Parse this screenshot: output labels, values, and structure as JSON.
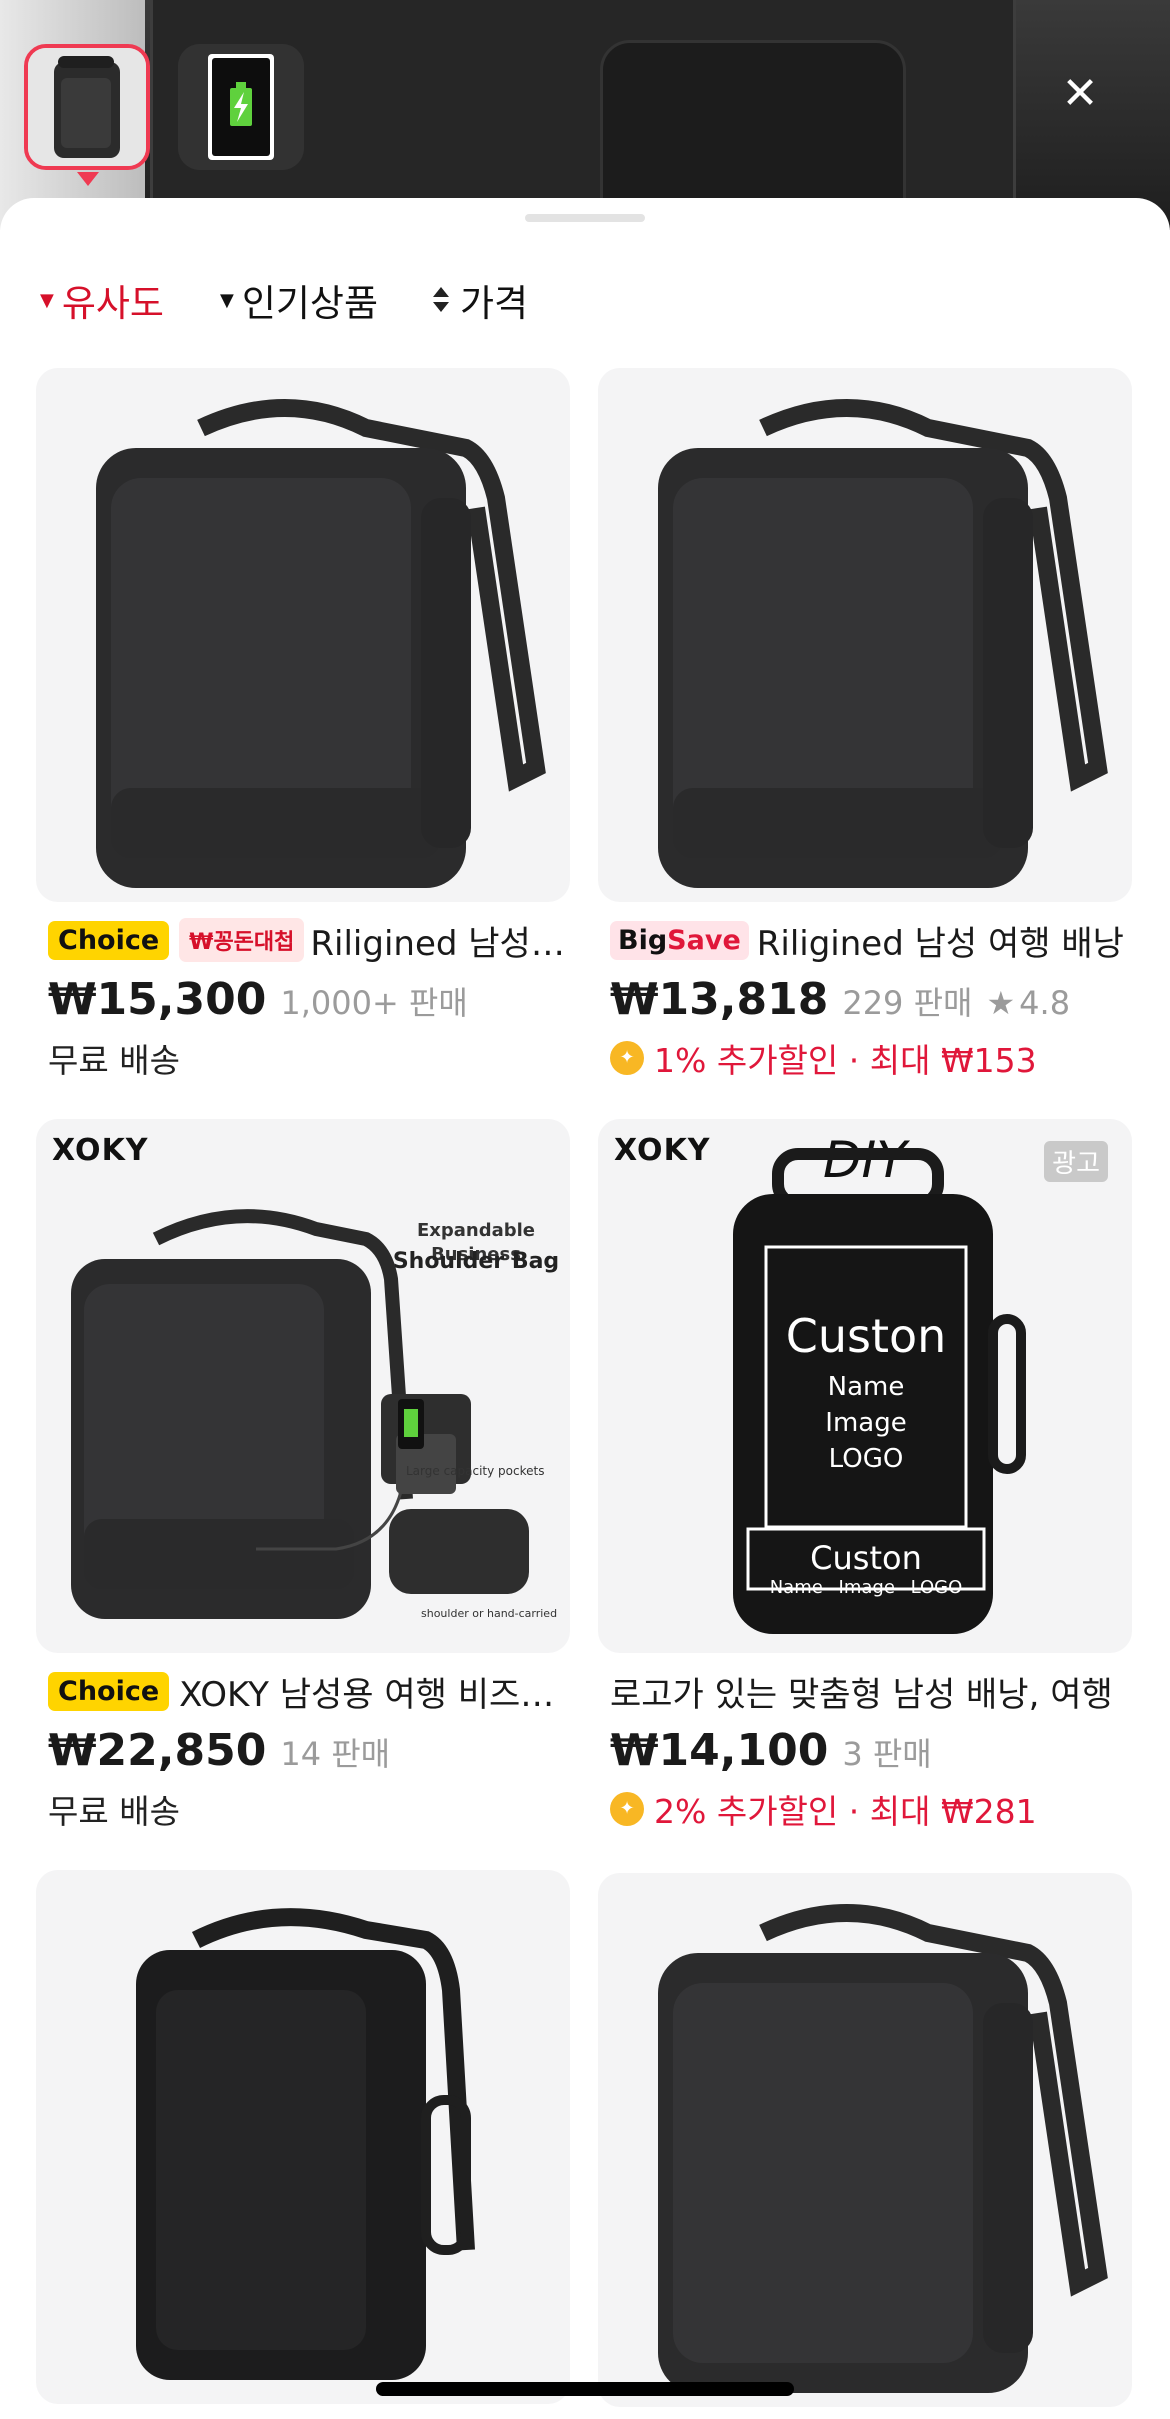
{
  "header": {
    "thumbnails": [
      {
        "icon": "backpack-icon",
        "selected": true
      },
      {
        "icon": "battery-charging-icon",
        "selected": false
      }
    ],
    "close_icon": "close-icon"
  },
  "sort": {
    "similarity": "유사도",
    "popular": "인기상품",
    "price": "가격"
  },
  "products": [
    {
      "badges": [
        "Choice",
        "₩꽁돈대첩"
      ],
      "title": "Riligined 남성 여행 배낭",
      "price": "₩15,300",
      "sold": "1,000+ 판매",
      "sub": "무료 배송"
    },
    {
      "badge_big": "Big",
      "badge_save": "Save",
      "title": "Riligined 남성 여행 배낭",
      "price": "₩13,818",
      "sold": "229 판매",
      "rating": "4.8",
      "promo": "1% 추가할인 · 최대 ₩153"
    },
    {
      "badges": [
        "Choice"
      ],
      "title": "XOKY 남성용 여행 비즈니스 배낭",
      "price": "₩22,850",
      "sold": "14 판매",
      "sub": "무료 배송",
      "brand": "XOKY",
      "caption1": "Expandable Business",
      "caption2": "Shoulder Bag",
      "caption3": "Large capacity pockets",
      "caption4": "shoulder or hand-carried"
    },
    {
      "title": "로고가 있는 맞춤형 남성 배낭, 여행",
      "price": "₩14,100",
      "sold": "3 판매",
      "promo": "2% 추가할인 · 최대 ₩281",
      "brand": "XOKY",
      "diy": "DIY",
      "ad": "광고",
      "custon": "Custon",
      "custon_lines": [
        "Name",
        "Image",
        "LOGO"
      ],
      "custon_small": "Custon",
      "custon_small_line": "Name Image LOGO"
    }
  ],
  "colors": {
    "accent": "#d6102a",
    "selected_border": "#ef3a52",
    "choice_yellow": "#ffd400",
    "card_bg": "#f4f4f5"
  }
}
